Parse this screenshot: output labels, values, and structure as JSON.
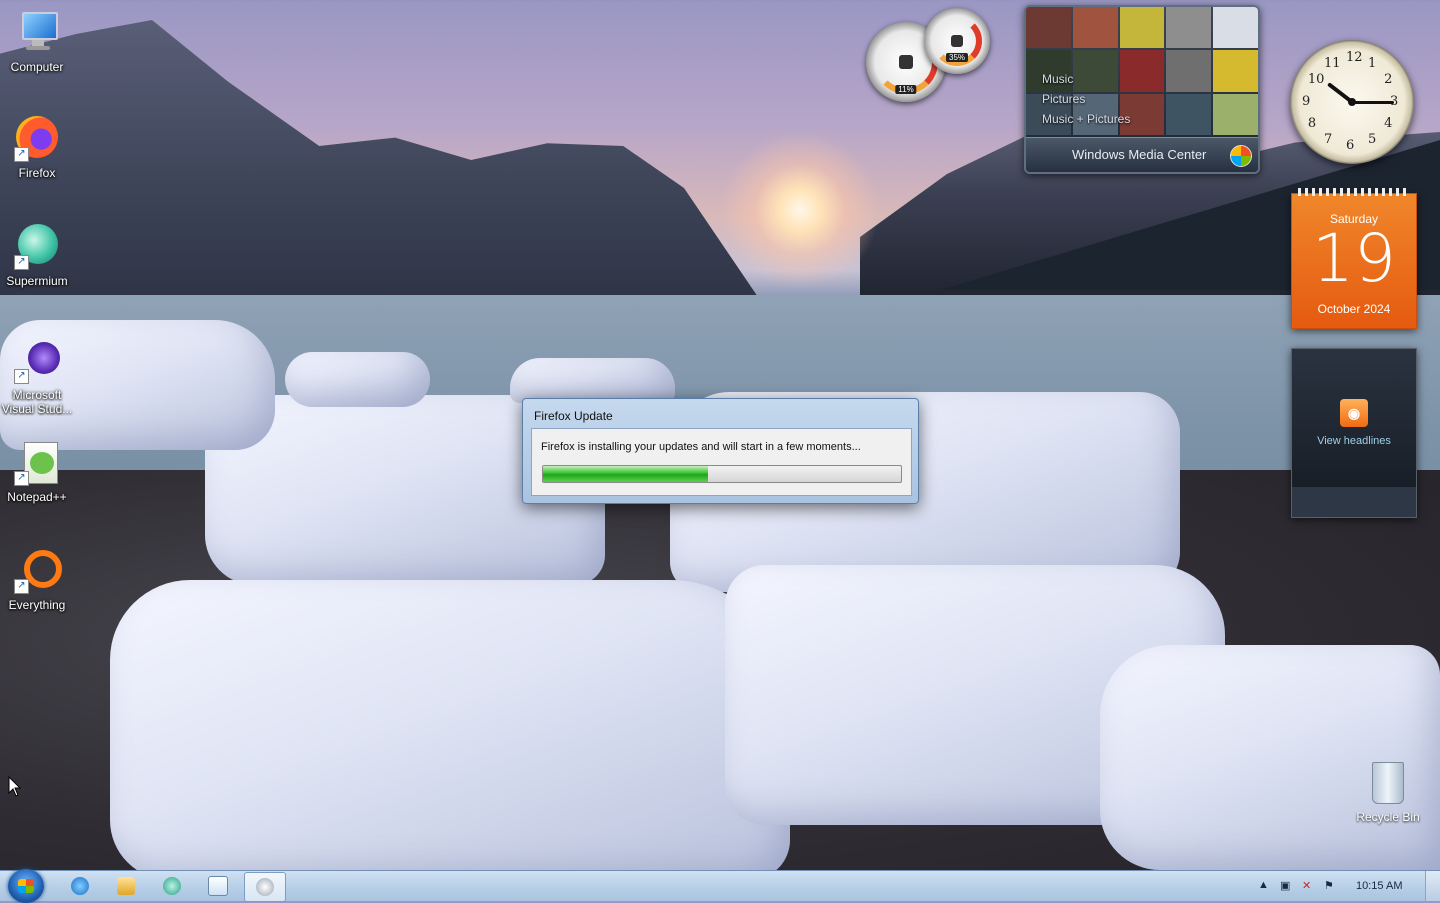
{
  "desktop": {
    "icons": [
      {
        "label": "Computer",
        "icon": "computer-icon"
      },
      {
        "label": "Firefox",
        "icon": "firefox-icon"
      },
      {
        "label": "Supermium",
        "icon": "supermium-icon"
      },
      {
        "label": "Microsoft Visual Stud...",
        "icon": "visual-studio-icon"
      },
      {
        "label": "Notepad++",
        "icon": "notepad-plus-plus-icon"
      },
      {
        "label": "Everything",
        "icon": "everything-icon"
      }
    ],
    "recycle_bin": {
      "label": "Recycle Bin",
      "icon": "recycle-bin-icon"
    }
  },
  "gadgets": {
    "cpu_meter": {
      "cpu": "11%",
      "memory": "35%"
    },
    "media_center": {
      "menu": [
        "Music",
        "Pictures",
        "Music + Pictures"
      ],
      "title": "Windows Media Center"
    },
    "clock": {
      "numbers": [
        "12",
        "1",
        "2",
        "3",
        "4",
        "5",
        "6",
        "7",
        "8",
        "9",
        "10",
        "11"
      ],
      "time": "10:15"
    },
    "calendar": {
      "weekday": "Saturday",
      "day": "19",
      "month_year": "October 2024"
    },
    "feed": {
      "link": "View headlines"
    }
  },
  "dialog": {
    "title": "Firefox Update",
    "message": "Firefox is installing your updates and will start in a few moments...",
    "progress": 0.46
  },
  "taskbar": {
    "items": [
      "internet-explorer-icon",
      "windows-explorer-icon",
      "supermium-icon",
      "notepad-icon",
      "firefox-updater-icon"
    ],
    "tray": {
      "time": "10:15 AM"
    }
  },
  "colors": {
    "calendar": "#e55a10",
    "progress": "#37c02c",
    "taskbar": "#b9d0e8"
  }
}
